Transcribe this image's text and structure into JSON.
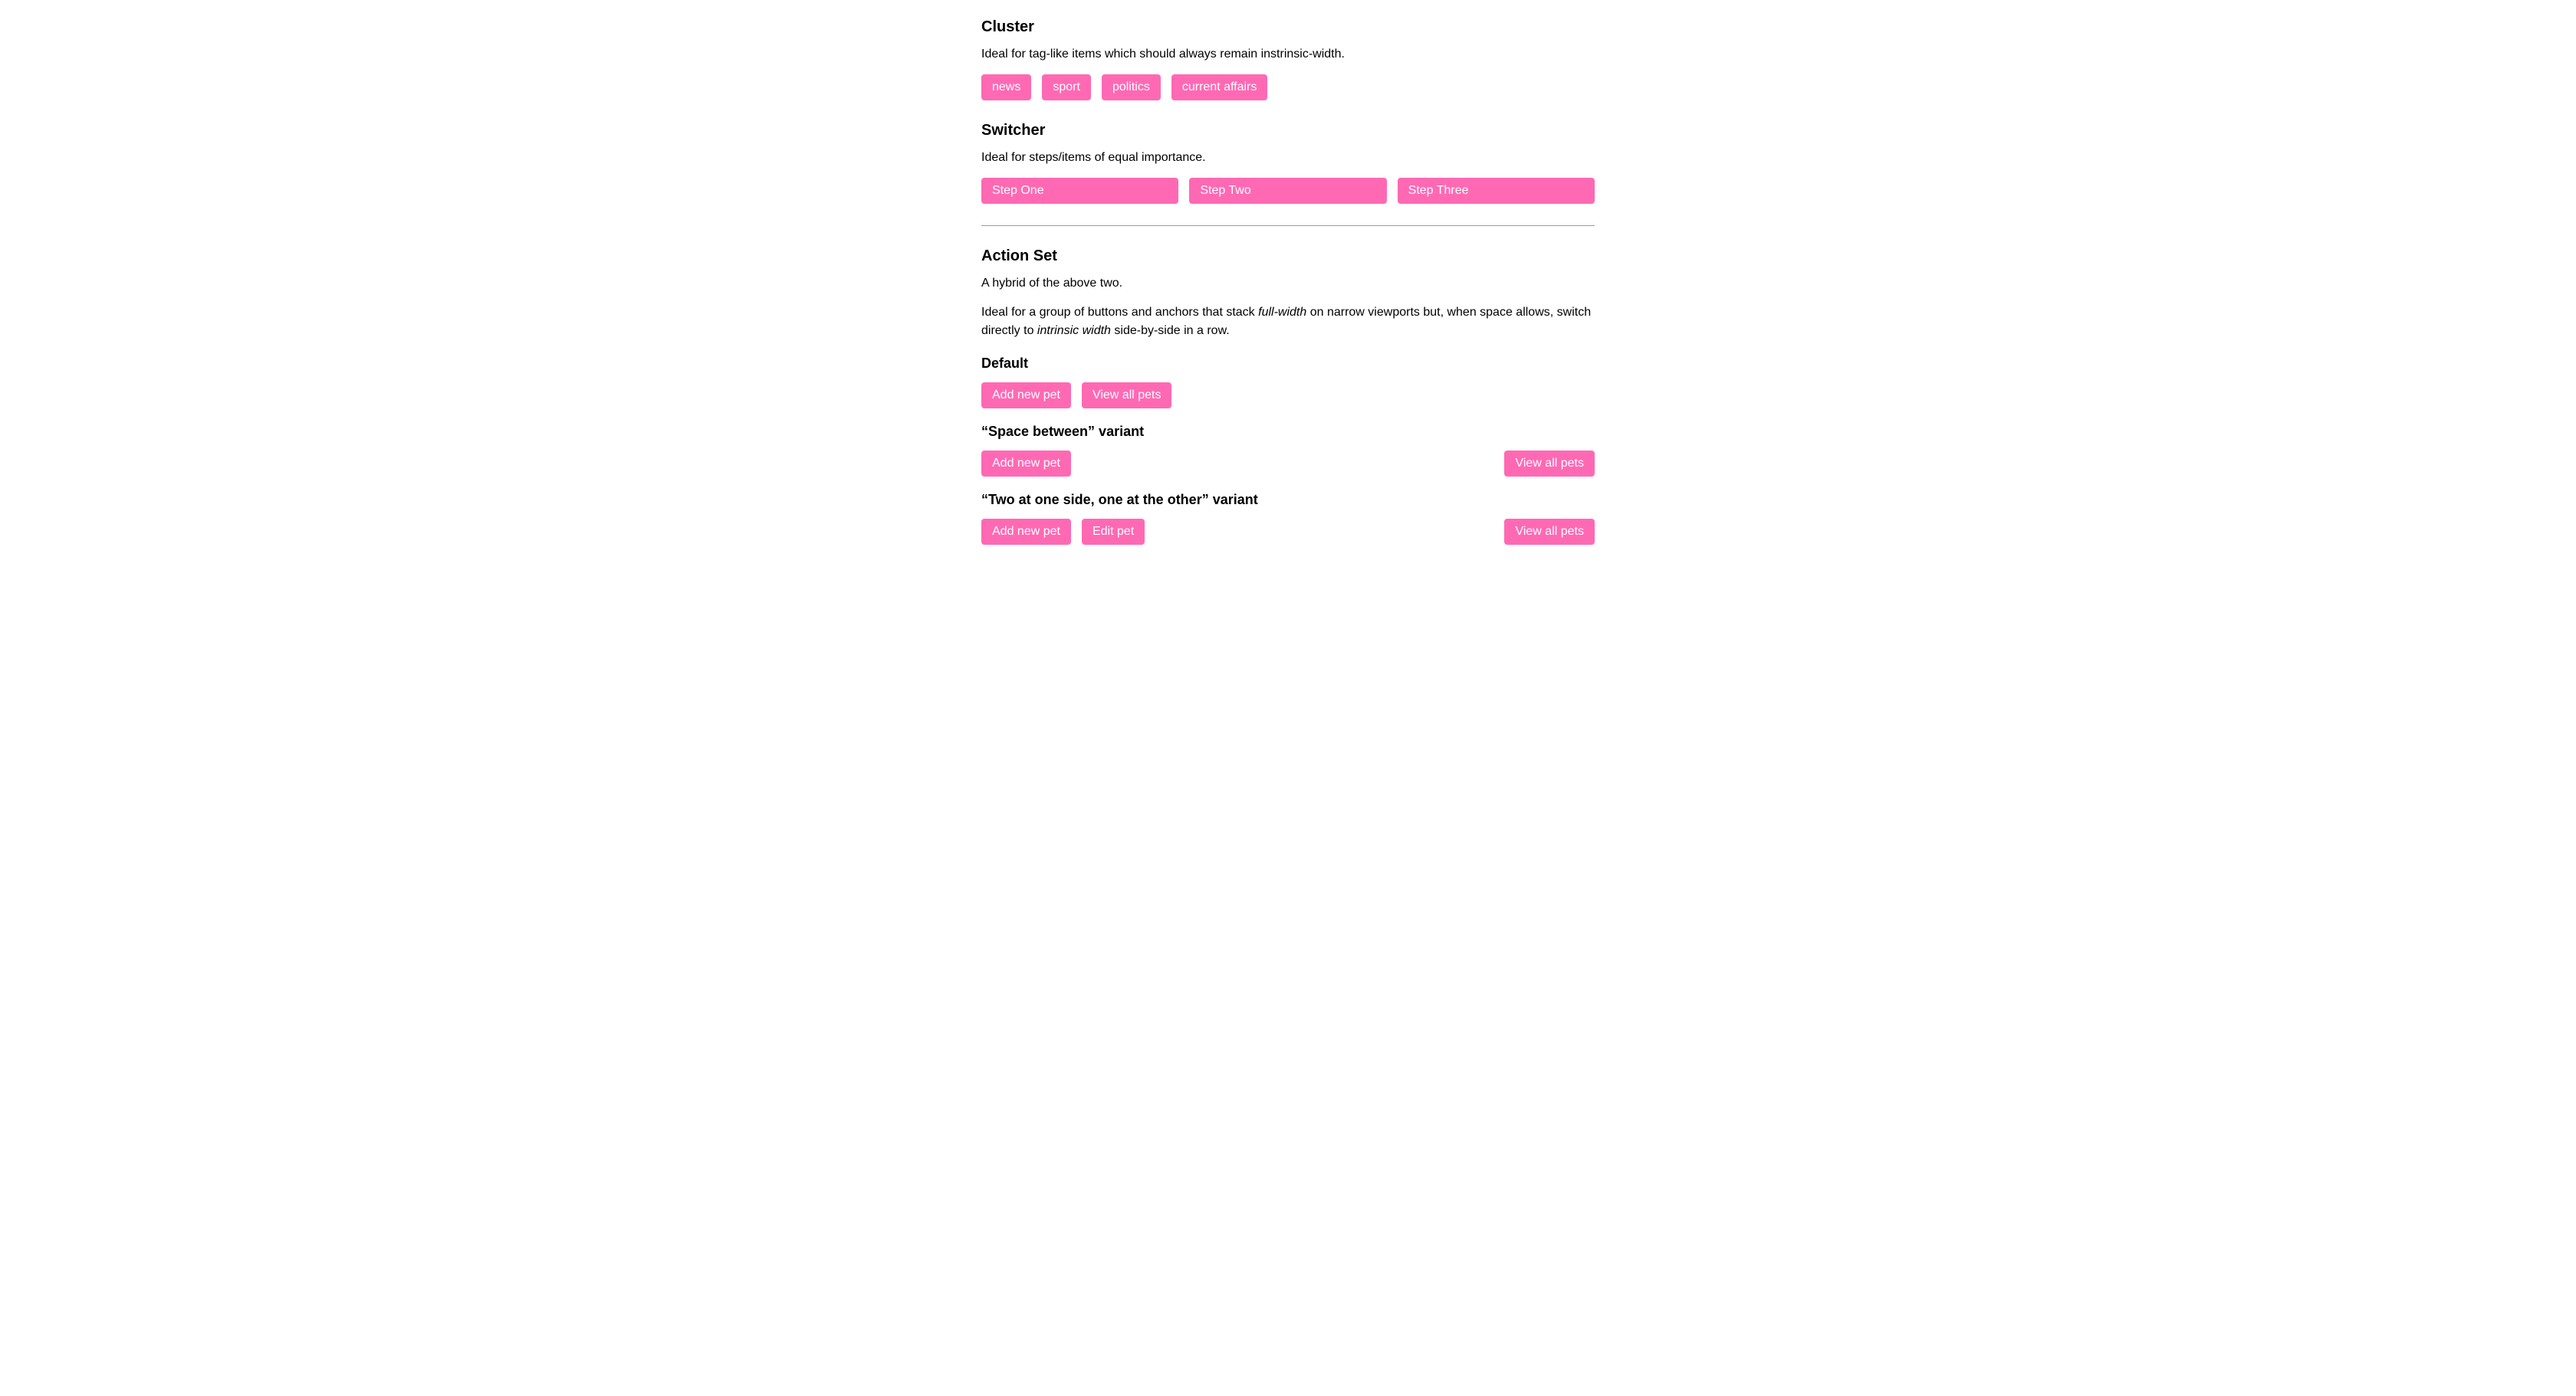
{
  "cluster": {
    "heading": "Cluster",
    "description": "Ideal for tag-like items which should always remain instrinsic-width.",
    "items": [
      "news",
      "sport",
      "politics",
      "current affairs"
    ]
  },
  "switcher": {
    "heading": "Switcher",
    "description": "Ideal for steps/items of equal importance.",
    "items": [
      "Step One",
      "Step Two",
      "Step Three"
    ]
  },
  "actionSet": {
    "heading": "Action Set",
    "description1": "A hybrid of the above two.",
    "description2_prefix": "Ideal for a group of buttons and anchors that stack ",
    "description2_em1": "full-width",
    "description2_mid": " on narrow viewports but, when space allows, switch directly to ",
    "description2_em2": "intrinsic width",
    "description2_suffix": " side-by-side in a row.",
    "default": {
      "heading": "Default",
      "items": [
        "Add new pet",
        "View all pets"
      ]
    },
    "spaceBetween": {
      "heading": "“Space between” variant",
      "left": "Add new pet",
      "right": "View all pets"
    },
    "twoOneSplit": {
      "heading": "“Two at one side, one at the other” variant",
      "left1": "Add new pet",
      "left2": "Edit pet",
      "right": "View all pets"
    }
  }
}
